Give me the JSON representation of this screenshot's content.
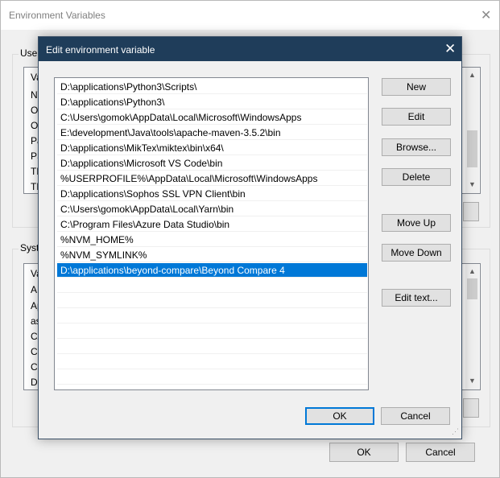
{
  "background_window": {
    "title": "Environment Variables",
    "user_group_label": "User",
    "user_list_rows": [
      "Va",
      "NV",
      "On",
      "On",
      "Pa",
      "PS",
      "TE",
      "TM"
    ],
    "system_group_label": "System",
    "system_list_rows": [
      "Va",
      "AN",
      "Ap",
      "as",
      "CA",
      "Ch",
      "Co",
      "Dr"
    ],
    "ok_label": "OK",
    "cancel_label": "Cancel"
  },
  "dialog": {
    "title": "Edit environment variable",
    "paths": [
      "D:\\applications\\Python3\\Scripts\\",
      "D:\\applications\\Python3\\",
      "C:\\Users\\gomok\\AppData\\Local\\Microsoft\\WindowsApps",
      "E:\\development\\Java\\tools\\apache-maven-3.5.2\\bin",
      "D:\\applications\\MikTex\\miktex\\bin\\x64\\",
      "D:\\applications\\Microsoft VS Code\\bin",
      "%USERPROFILE%\\AppData\\Local\\Microsoft\\WindowsApps",
      "D:\\applications\\Sophos SSL VPN Client\\bin",
      "C:\\Users\\gomok\\AppData\\Local\\Yarn\\bin",
      "C:\\Program Files\\Azure Data Studio\\bin",
      "%NVM_HOME%",
      "%NVM_SYMLINK%",
      "D:\\applications\\beyond-compare\\Beyond Compare 4"
    ],
    "selected_index": 12,
    "buttons": {
      "new": "New",
      "edit": "Edit",
      "browse": "Browse...",
      "delete": "Delete",
      "move_up": "Move Up",
      "move_down": "Move Down",
      "edit_text": "Edit text...",
      "ok": "OK",
      "cancel": "Cancel"
    }
  },
  "colors": {
    "title_bar": "#1f3d5a",
    "selection": "#0078d7",
    "window_bg": "#f0f0f0"
  },
  "icons": [
    "close-icon",
    "scroll-up-icon",
    "scroll-down-icon",
    "resize-grip-icon"
  ]
}
